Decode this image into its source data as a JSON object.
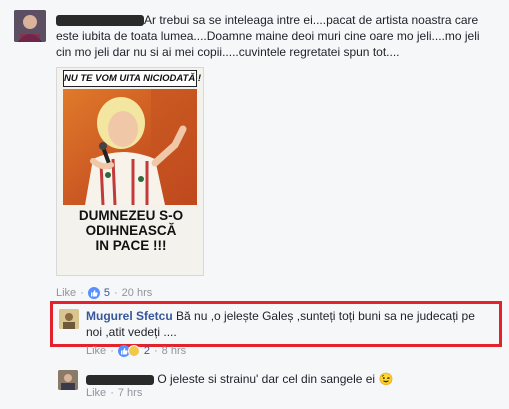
{
  "comment1": {
    "text": "Ar trebui sa se inteleaga intre ei....pacat de artista noastra care este iubita de toata lumea....Doamne maine deoi muri cine oare mo jeli....mo jeli cin mo jeli dar nu si ai mei copii.....cuvintele regretatei spun tot....",
    "like_label": "Like",
    "reaction_count": "5",
    "time": "20 hrs",
    "image": {
      "banner": "NU TE VOM UITA NICIODATĂ !",
      "caption_line1": "DUMNEZEU S-O",
      "caption_line2": "ODIHNEASCĂ",
      "caption_line3": "IN PACE !!!"
    }
  },
  "reply1": {
    "author": "Mugurel Sfetcu",
    "text": "Bă nu ,o jelește Galeș ,sunteți toți buni sa ne judecați pe noi ,atit vedeți ....",
    "like_label": "Like",
    "reaction_count": "2",
    "time": "8 hrs"
  },
  "reply2": {
    "text": "O jeleste si strainu' dar cel din sangele ei",
    "emoji": "😉",
    "like_label": "Like",
    "time": "7 hrs"
  },
  "colors": {
    "link": "#365899",
    "meta": "#90949c",
    "highlight": "#e5212b",
    "like_blue": "#5890ff"
  }
}
